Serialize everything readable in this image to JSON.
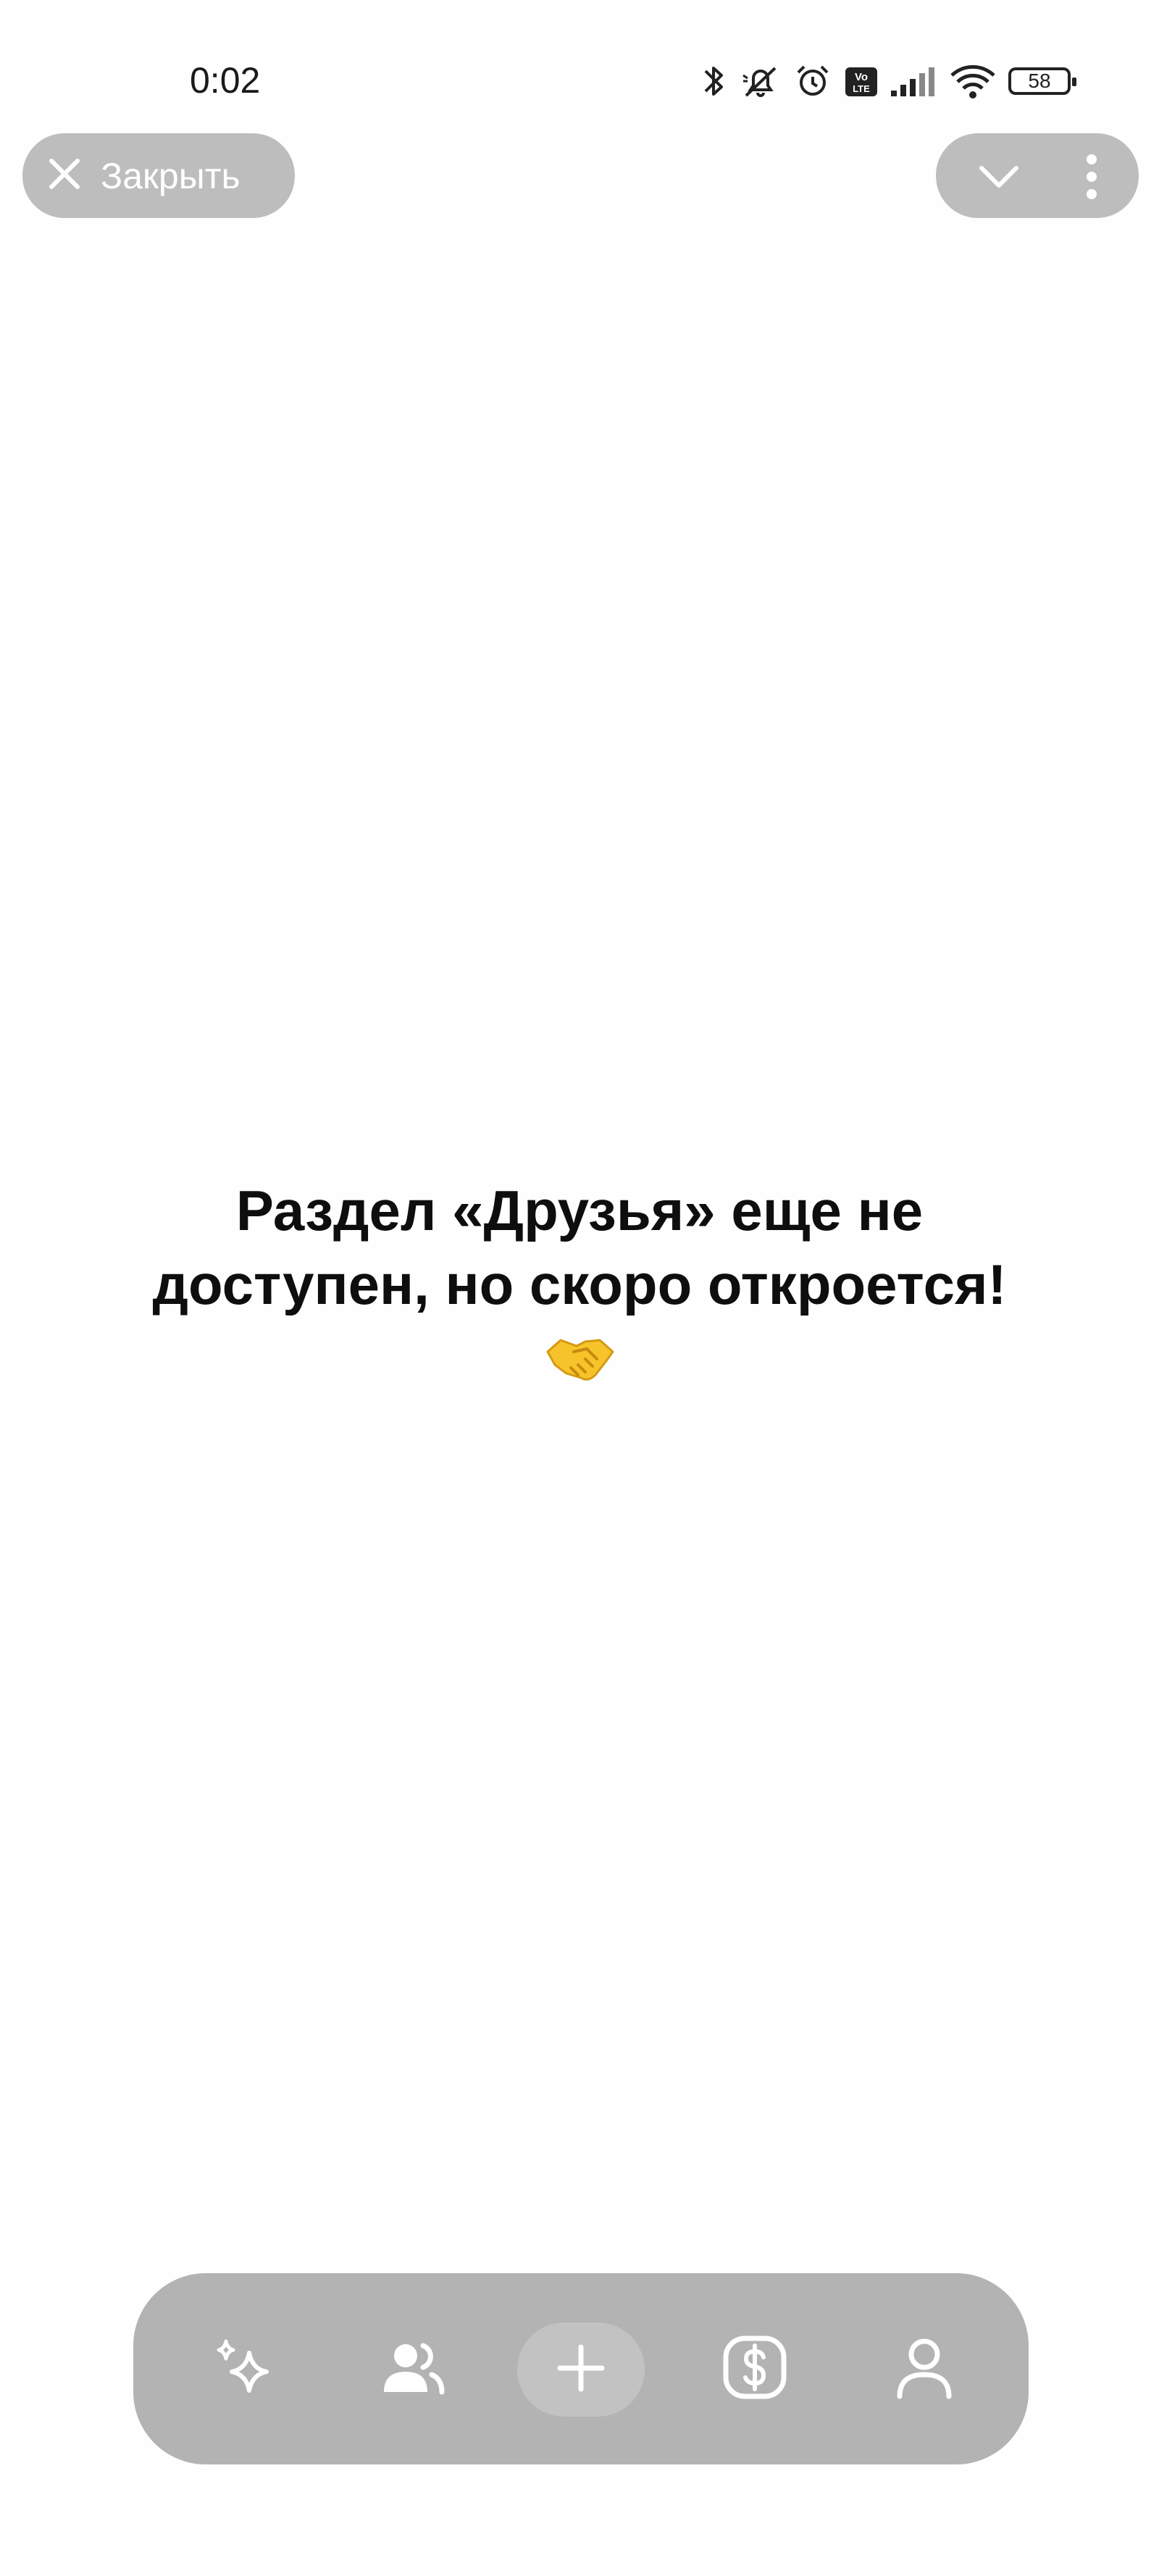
{
  "status_bar": {
    "time": "0:02",
    "battery_level": "58",
    "icons": [
      "bluetooth-icon",
      "muted-bell-icon",
      "alarm-icon",
      "volte-icon",
      "signal-icon",
      "wifi-icon",
      "battery-icon"
    ]
  },
  "header": {
    "close_label": "Закрыть",
    "close_icon": "close-icon",
    "collapse_icon": "chevron-down-icon",
    "menu_icon": "more-vertical-icon"
  },
  "main": {
    "message_line1": "Раздел «Друзья» еще не",
    "message_line2": "доступен, но скоро откроется!",
    "emoji": "handshake-emoji"
  },
  "bottom_nav": {
    "items": [
      {
        "icon": "sparkles-icon"
      },
      {
        "icon": "friends-icon"
      },
      {
        "icon": "plus-icon"
      },
      {
        "icon": "dollar-icon"
      },
      {
        "icon": "profile-icon"
      }
    ]
  },
  "colors": {
    "pill_bg": "#bdbdbd",
    "nav_bg": "#b3b3b3",
    "icon_fg": "#ffffff",
    "text": "#0e0e0e"
  }
}
